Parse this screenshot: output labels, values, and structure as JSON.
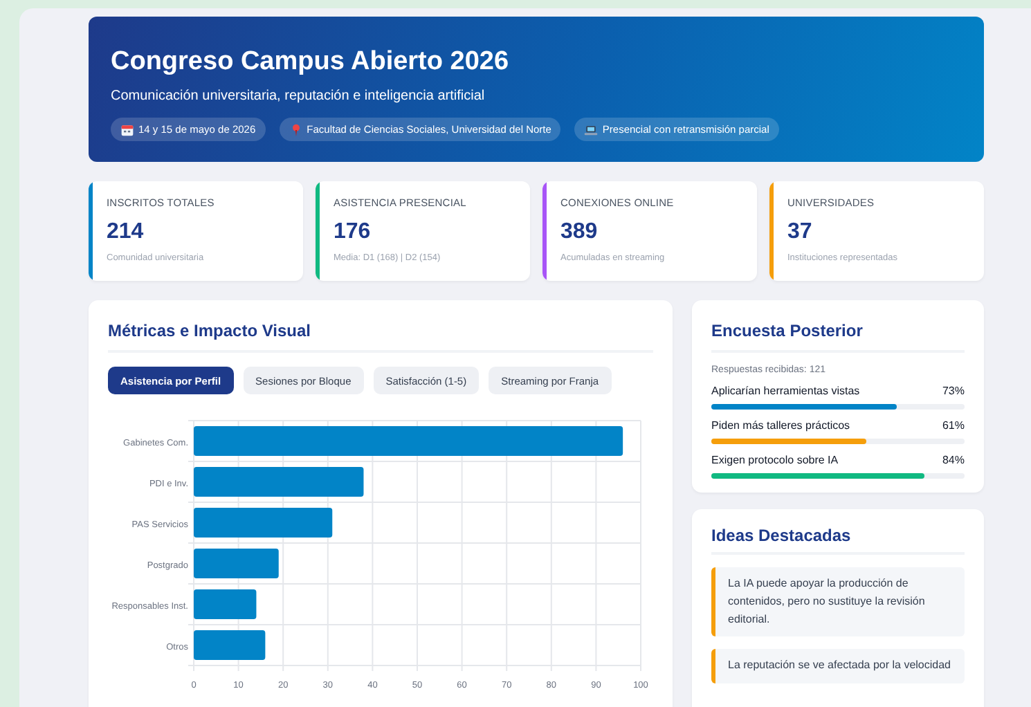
{
  "header": {
    "title": "Congreso Campus Abierto 2026",
    "subtitle": "Comunicación universitaria, reputación e inteligencia artificial",
    "chips": [
      {
        "kind": "calendar",
        "label": "14 y 15 de mayo de 2026"
      },
      {
        "kind": "pin",
        "label": "Facultad de Ciencias Sociales, Universidad del Norte"
      },
      {
        "kind": "laptop",
        "label": "Presencial con retransmisión parcial"
      }
    ]
  },
  "stats": [
    {
      "label": "INSCRITOS TOTALES",
      "value": "214",
      "note": "Comunidad universitaria",
      "color": "#0284c7"
    },
    {
      "label": "ASISTENCIA PRESENCIAL",
      "value": "176",
      "note": "Media: D1 (168) | D2 (154)",
      "color": "#10b981"
    },
    {
      "label": "CONEXIONES ONLINE",
      "value": "389",
      "note": "Acumuladas en streaming",
      "color": "#a855f7"
    },
    {
      "label": "UNIVERSIDADES",
      "value": "37",
      "note": "Instituciones representadas",
      "color": "#f59e0b"
    }
  ],
  "metrics": {
    "title": "Métricas e Impacto Visual",
    "tabs": [
      {
        "label": "Asistencia por Perfil",
        "selected": true
      },
      {
        "label": "Sesiones por Bloque",
        "selected": false
      },
      {
        "label": "Satisfacción (1-5)",
        "selected": false
      },
      {
        "label": "Streaming por Franja",
        "selected": false
      }
    ],
    "chart_data": {
      "type": "bar",
      "orientation": "horizontal",
      "categories": [
        "Gabinetes Com.",
        "PDI e Inv.",
        "PAS Servicios",
        "Postgrado",
        "Responsables Inst.",
        "Otros"
      ],
      "series": [
        {
          "color": "#0284c7",
          "values": [
            96,
            38,
            31,
            19,
            14,
            16
          ]
        }
      ],
      "grid": true,
      "xlim": [
        0,
        100
      ],
      "xticks": [
        0,
        10,
        20,
        30,
        40,
        50,
        60,
        70,
        80,
        90,
        100
      ]
    }
  },
  "survey": {
    "title": "Encuesta Posterior",
    "responses": "Respuestas recibidas: 121",
    "items": [
      {
        "label": "Aplicarían herramientas vistas",
        "value": "73%",
        "level": 0.73,
        "color": "#0284c7"
      },
      {
        "label": "Piden más talleres prácticos",
        "value": "61%",
        "level": 0.61,
        "color": "#f59e0b"
      },
      {
        "label": "Exigen protocolo sobre IA",
        "value": "84%",
        "level": 0.84,
        "color": "#10b981"
      }
    ]
  },
  "ideas": {
    "title": "Ideas Destacadas",
    "items": [
      "La IA puede apoyar la producción de contenidos, pero no sustituye la revisión editorial.",
      "La reputación se ve afectada por la velocidad"
    ]
  }
}
